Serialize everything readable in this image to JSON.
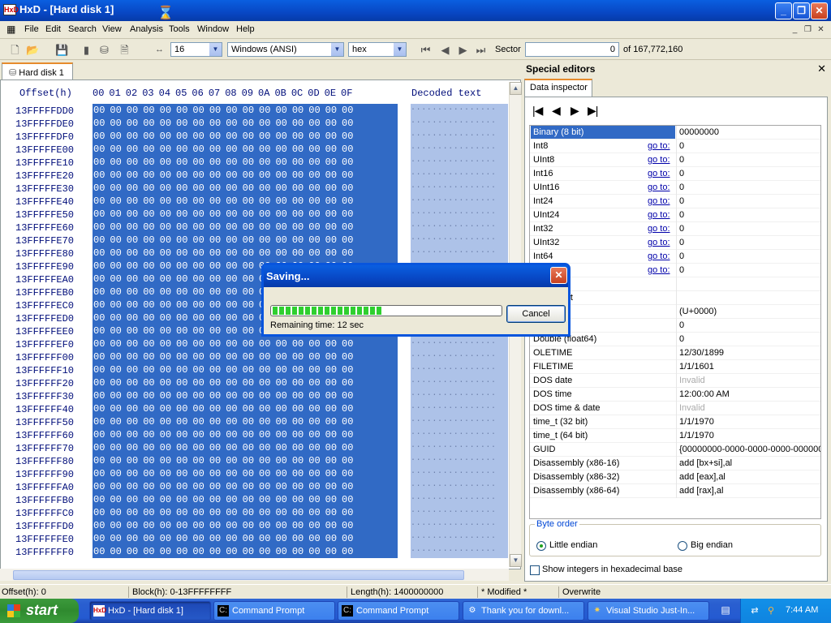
{
  "window": {
    "title": "HxD - [Hard disk 1]",
    "app_icon": "HxD"
  },
  "menu": [
    "File",
    "Edit",
    "Search",
    "View",
    "Analysis",
    "Tools",
    "Window",
    "Help"
  ],
  "toolbar": {
    "bytes_per_row": "16",
    "charset": "Windows (ANSI)",
    "base": "hex",
    "sector_label": "Sector",
    "sector_value": "0",
    "sector_total": "of 167,772,160"
  },
  "doc_tab": "Hard disk 1",
  "hex": {
    "offset_header": "Offset(h)",
    "columns": "00 01 02 03 04 05 06 07 08 09 0A 0B 0C 0D 0E 0F",
    "decoded_header": "Decoded text",
    "offsets": [
      "13FFFFFDD0",
      "13FFFFFDE0",
      "13FFFFFDF0",
      "13FFFFFE00",
      "13FFFFFE10",
      "13FFFFFE20",
      "13FFFFFE30",
      "13FFFFFE40",
      "13FFFFFE50",
      "13FFFFFE60",
      "13FFFFFE70",
      "13FFFFFE80",
      "13FFFFFE90",
      "13FFFFFEA0",
      "13FFFFFEB0",
      "13FFFFFEC0",
      "13FFFFFED0",
      "13FFFFFEE0",
      "13FFFFFEF0",
      "13FFFFFF00",
      "13FFFFFF10",
      "13FFFFFF20",
      "13FFFFFF30",
      "13FFFFFF40",
      "13FFFFFF50",
      "13FFFFFF60",
      "13FFFFFF70",
      "13FFFFFF80",
      "13FFFFFF90",
      "13FFFFFFA0",
      "13FFFFFFB0",
      "13FFFFFFC0",
      "13FFFFFFD0",
      "13FFFFFFE0",
      "13FFFFFFF0"
    ],
    "row_bytes": "00 00 00 00 00 00 00 00 00 00 00 00 00 00 00 00",
    "row_decoded": "................"
  },
  "status": {
    "offset": "Offset(h): 0",
    "block": "Block(h): 0-13FFFFFFFF",
    "length": "Length(h): 1400000000",
    "modified": "* Modified *",
    "mode": "Overwrite"
  },
  "side": {
    "header": "Special editors",
    "tab": "Data inspector",
    "rows": [
      {
        "name": "Binary (8 bit)",
        "goto": "",
        "value": "00000000"
      },
      {
        "name": "Int8",
        "goto": "go to:",
        "value": "0"
      },
      {
        "name": "UInt8",
        "goto": "go to:",
        "value": "0"
      },
      {
        "name": "Int16",
        "goto": "go to:",
        "value": "0"
      },
      {
        "name": "UInt16",
        "goto": "go to:",
        "value": "0"
      },
      {
        "name": "Int24",
        "goto": "go to:",
        "value": "0"
      },
      {
        "name": "UInt24",
        "goto": "go to:",
        "value": "0"
      },
      {
        "name": "Int32",
        "goto": "go to:",
        "value": "0"
      },
      {
        "name": "UInt32",
        "goto": "go to:",
        "value": "0"
      },
      {
        "name": "Int64",
        "goto": "go to:",
        "value": "0"
      },
      {
        "name": "",
        "goto": "go to:",
        "value": "0"
      },
      {
        "name": "/ char8_t",
        "goto": "",
        "value": ""
      },
      {
        "name": "/ char16_t",
        "goto": "",
        "value": ""
      },
      {
        "name": "de point",
        "goto": "",
        "value": " (U+0000)"
      },
      {
        "name": "at32)",
        "goto": "",
        "value": "0"
      },
      {
        "name": "Double (float64)",
        "goto": "",
        "value": "0"
      },
      {
        "name": "OLETIME",
        "goto": "",
        "value": "12/30/1899"
      },
      {
        "name": "FILETIME",
        "goto": "",
        "value": "1/1/1601"
      },
      {
        "name": "DOS date",
        "goto": "",
        "value": "Invalid"
      },
      {
        "name": "DOS time",
        "goto": "",
        "value": "12:00:00 AM"
      },
      {
        "name": "DOS time & date",
        "goto": "",
        "value": "Invalid"
      },
      {
        "name": "time_t (32 bit)",
        "goto": "",
        "value": "1/1/1970"
      },
      {
        "name": "time_t (64 bit)",
        "goto": "",
        "value": "1/1/1970"
      },
      {
        "name": "GUID",
        "goto": "",
        "value": "{00000000-0000-0000-0000-000000"
      },
      {
        "name": "Disassembly (x86-16)",
        "goto": "",
        "value": "add [bx+si],al"
      },
      {
        "name": "Disassembly (x86-32)",
        "goto": "",
        "value": "add [eax],al"
      },
      {
        "name": "Disassembly (x86-64)",
        "goto": "",
        "value": "add [rax],al"
      }
    ],
    "byte_order": "Byte order",
    "little": "Little endian",
    "big": "Big endian",
    "hex_base": "Show integers in hexadecimal base"
  },
  "dialog": {
    "title": "Saving...",
    "cancel": "Cancel",
    "remaining": "Remaining time: 12 sec",
    "progress": 0.48
  },
  "taskbar": {
    "start": "start",
    "tasks": [
      "HxD - [Hard disk 1]",
      "Command Prompt",
      "Command Prompt",
      "Thank you for downl...",
      "Visual Studio Just-In..."
    ],
    "clock": "7:44 AM"
  }
}
